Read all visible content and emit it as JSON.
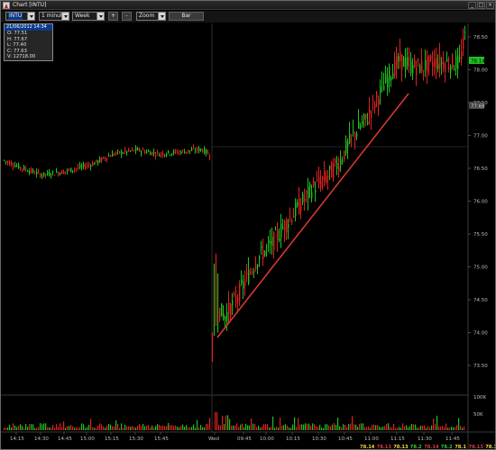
{
  "window": {
    "title": "Chart [INTU]",
    "minimize": "_",
    "maximize": "□",
    "close": "×"
  },
  "toolbar": {
    "symbol": "INTU",
    "interval": "1 minute",
    "range": "Week",
    "plus": "+",
    "minus": "-",
    "zoom": "Zoom",
    "bar": "Bar"
  },
  "info": {
    "date": "21/06/2012 14:34",
    "open": "O: 77.51",
    "high": "H: 77.67",
    "low": "L: 77.40",
    "close": "C: 77.63",
    "volume": "V: 12718.00"
  },
  "y_labels": [
    "78.50",
    "78.00",
    "77.50",
    "77.00",
    "76.50",
    "76.00",
    "75.50",
    "75.00",
    "74.50",
    "74.00",
    "73.50"
  ],
  "price_tags": {
    "last": "78.14",
    "marker": "77.68"
  },
  "volume_labels": [
    "100K",
    "50K"
  ],
  "x_labels": [
    "14:15",
    "14:30",
    "14:45",
    "15:00",
    "15:15",
    "15:30",
    "15:45",
    "Wed",
    "09:45",
    "10:00",
    "10:15",
    "10:30",
    "10:45",
    "11:00",
    "11:15",
    "11:30",
    "11:45"
  ],
  "quote_strip": [
    {
      "text": "78.14",
      "color": "#f0d840"
    },
    {
      "text": "78.13",
      "color": "#d04040"
    },
    {
      "text": "78.13",
      "color": "#f0d840"
    },
    {
      "text": "78.2",
      "color": "#40c040"
    },
    {
      "text": "78.14",
      "color": "#d04040"
    },
    {
      "text": "78.2",
      "color": "#40c040"
    },
    {
      "text": "78.1",
      "color": "#f0d840"
    },
    {
      "text": "78.13",
      "color": "#d04040"
    },
    {
      "text": "78.12",
      "color": "#f0d840"
    },
    {
      "text": "78.1",
      "color": "#40c040"
    }
  ],
  "colors": {
    "up": "#20c020",
    "down": "#e02020",
    "trendline": "#e03a30",
    "background": "#000000"
  }
}
